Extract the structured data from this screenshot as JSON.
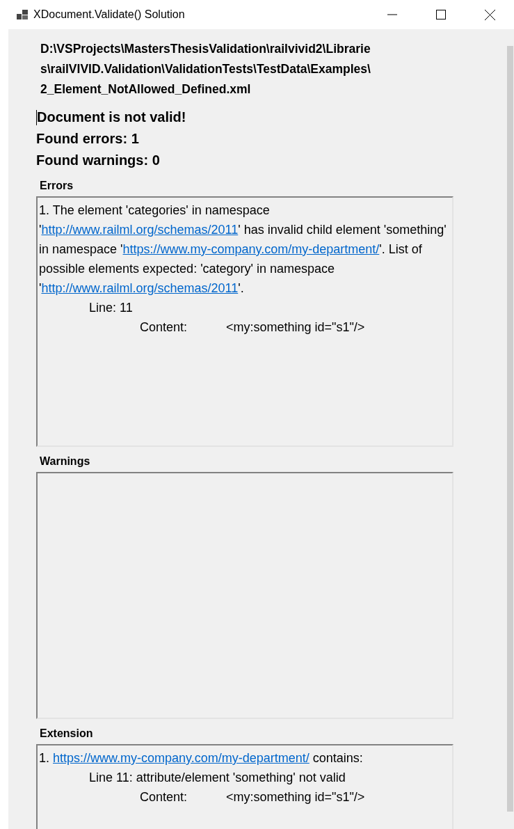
{
  "window": {
    "title": "XDocument.Validate() Solution"
  },
  "file_path_lines": [
    "D:\\VSProjects\\MastersThesisValidation\\railvivid2\\Librarie",
    "s\\railVIVID.Validation\\ValidationTests\\TestData\\Examples\\",
    "2_Element_NotAllowed_Defined.xml"
  ],
  "summary": [
    "Document is not valid!",
    "Found errors: 1",
    "Found warnings: 0"
  ],
  "errors": {
    "label": "Errors",
    "entries": [
      {
        "message": [
          {
            "text": "1. The element 'categories' in namespace '",
            "link": false
          },
          {
            "text": "http://www.railml.org/schemas/2011",
            "link": true
          },
          {
            "text": "' has invalid child element 'something' in namespace '",
            "link": false
          },
          {
            "text": "https://www.my-company.com/my-department/",
            "link": true
          },
          {
            "text": "'. List of possible elements expected: 'category' in namespace '",
            "link": false
          },
          {
            "text": "http://www.railml.org/schemas/2011",
            "link": true
          },
          {
            "text": "'.",
            "link": false
          }
        ],
        "line": "Line: 11",
        "content_label": "Content:",
        "content": "<my:something id=\"s1\"/>"
      }
    ]
  },
  "warnings": {
    "label": "Warnings"
  },
  "extension": {
    "label": "Extension",
    "entries": [
      {
        "message": [
          {
            "text": "1. ",
            "link": false
          },
          {
            "text": "https://www.my-company.com/my-department/",
            "link": true
          },
          {
            "text": " contains:",
            "link": false
          }
        ],
        "line": "Line 11: attribute/element 'something' not valid",
        "content_label": "Content:",
        "content": "<my:something id=\"s1\"/>"
      }
    ]
  }
}
